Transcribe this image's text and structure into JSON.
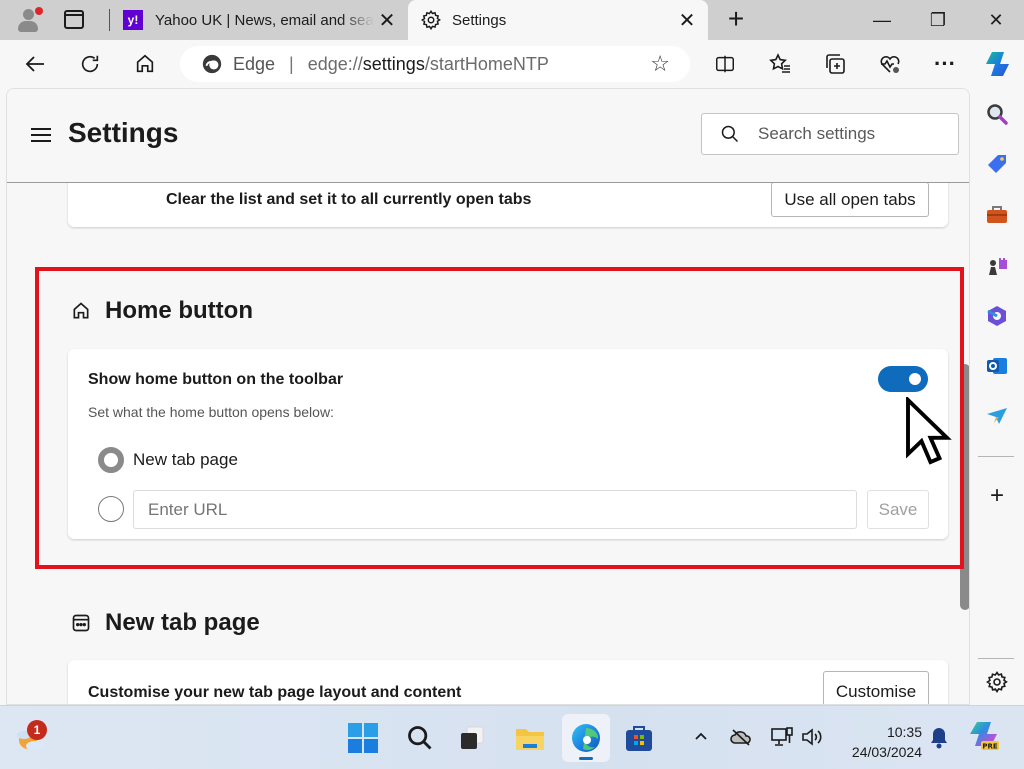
{
  "browser": {
    "tabs": [
      {
        "title": "Yahoo UK | News, email and search",
        "favicon": "yahoo-favicon",
        "active": false
      },
      {
        "title": "Settings",
        "favicon": "gear-icon",
        "active": true
      }
    ],
    "close_glyph": "✕",
    "new_tab_glyph": "+",
    "window_controls": {
      "minimize": "—",
      "maximize": "❐",
      "close": "✕"
    },
    "address_bar": {
      "site_label": "Edge",
      "url_prefix": "edge://",
      "url_bold": "settings",
      "url_suffix": "/startHomeNTP"
    }
  },
  "settings": {
    "title": "Settings",
    "search_placeholder": "Search settings",
    "open_tabs_card": {
      "text": "Clear the list and set it to all currently open tabs",
      "button": "Use all open tabs"
    },
    "home_button": {
      "heading": "Home button",
      "toggle_label": "Show home button on the toolbar",
      "toggle_on": true,
      "subtext": "Set what the home button opens below:",
      "options": [
        {
          "label": "New tab page",
          "selected": true
        },
        {
          "label": "",
          "selected": false
        }
      ],
      "url_placeholder": "Enter URL",
      "url_value": "",
      "save_label": "Save"
    },
    "new_tab_page": {
      "heading": "New tab page",
      "text": "Customise your new tab page layout and content",
      "button": "Customise"
    }
  },
  "sidebar": {
    "icons": [
      "search-icon",
      "shopping-tag-icon",
      "tools-icon",
      "games-icon",
      "microsoft365-icon",
      "outlook-icon",
      "drop-icon"
    ],
    "add_glyph": "+"
  },
  "taskbar": {
    "weather_badge": "1",
    "apps": [
      "start",
      "search",
      "task-view",
      "file-explorer",
      "edge",
      "microsoft-store"
    ],
    "tray_chevron": "^",
    "time": "10:35",
    "date": "24/03/2024",
    "copilot_badge": "PRE"
  },
  "colors": {
    "accent": "#0f6cbd",
    "highlight_border": "#e3121b",
    "yahoo": "#6001d2"
  }
}
